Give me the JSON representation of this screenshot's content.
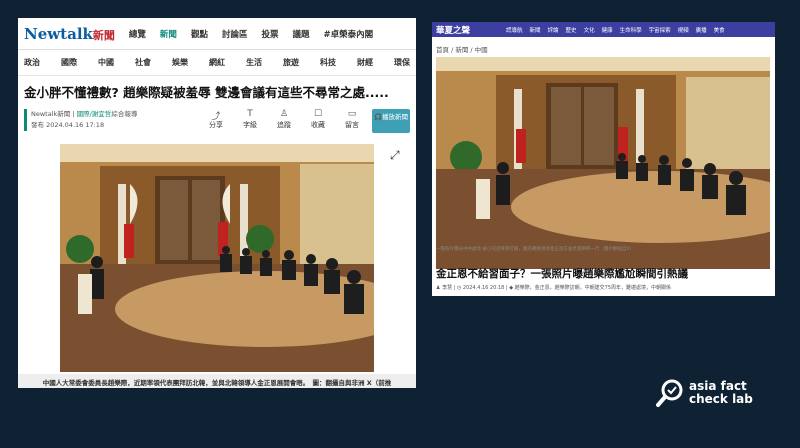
{
  "left_article": {
    "logo": "Newtalk",
    "logo_cn": "新聞",
    "nav": [
      "總覽",
      "新聞",
      "觀點",
      "討論區",
      "投票",
      "議題",
      "#卓榮泰內閣"
    ],
    "nav_active_index": 1,
    "categories": [
      "政治",
      "國際",
      "中國",
      "社會",
      "娛樂",
      "網紅",
      "生活",
      "旅遊",
      "科技",
      "財經",
      "環保"
    ],
    "headline": "金小胖不懂禮數? 趙樂際疑被羞辱 雙邊會議有這些不尋常之處.....",
    "source": "Newtalk新聞 | ",
    "source_link": "國際/謝宜哲",
    "source_suffix": "綜合報導",
    "published": "發布 2024.04.16 17:18",
    "tools": [
      {
        "icon": "share-icon",
        "glyph": "⤴",
        "label": "分享"
      },
      {
        "icon": "font-size-icon",
        "glyph": "T",
        "label": "字級"
      },
      {
        "icon": "follow-icon",
        "glyph": "♙",
        "label": "追蹤"
      },
      {
        "icon": "bookmark-icon",
        "glyph": "☐",
        "label": "收藏"
      },
      {
        "icon": "comment-icon",
        "glyph": "▭",
        "label": "留言"
      }
    ],
    "play_label": "播放新聞",
    "caption": "中國人大常委會委員長趙樂際，近期率領代表團拜訪北韓，並與北韓領導人金正恩展開會晤。　圖：翻攝自與非洲 X（前推特）帳號"
  },
  "right_article": {
    "logo": "華夏之聲",
    "nav": [
      "謊導航",
      "新聞",
      "評論",
      "歷史",
      "文化",
      "健康",
      "生命科學",
      "宇宙探索",
      "視頻",
      "廣播",
      "美食"
    ],
    "breadcrumb": "首頁 / 新聞 / 中國",
    "photo_caption": "一張照片曝光中共處境 被小兄弟摔晾打臉，圖為朝鮮領導金正恩在會見趙樂際一行（圖片翻拍自X）",
    "headline": "金正恩不給習面子？一張照片曝趙樂際尷尬瞬間引熱議",
    "meta": "♟ 李慧 | ◷ 2024.4.16 20:18 | ◆ 趙樂際，金正恩，趙樂際訪朝，中朝建交75周年，難堪處境，中朝關係"
  },
  "watermark": {
    "line1": "asia fact",
    "line2": "check lab"
  },
  "colors": {
    "background": "#0f2233",
    "newtalk_blue": "#0b5da0",
    "newtalk_teal": "#0b8a7a",
    "ct_nav": "#3d3fa0"
  }
}
